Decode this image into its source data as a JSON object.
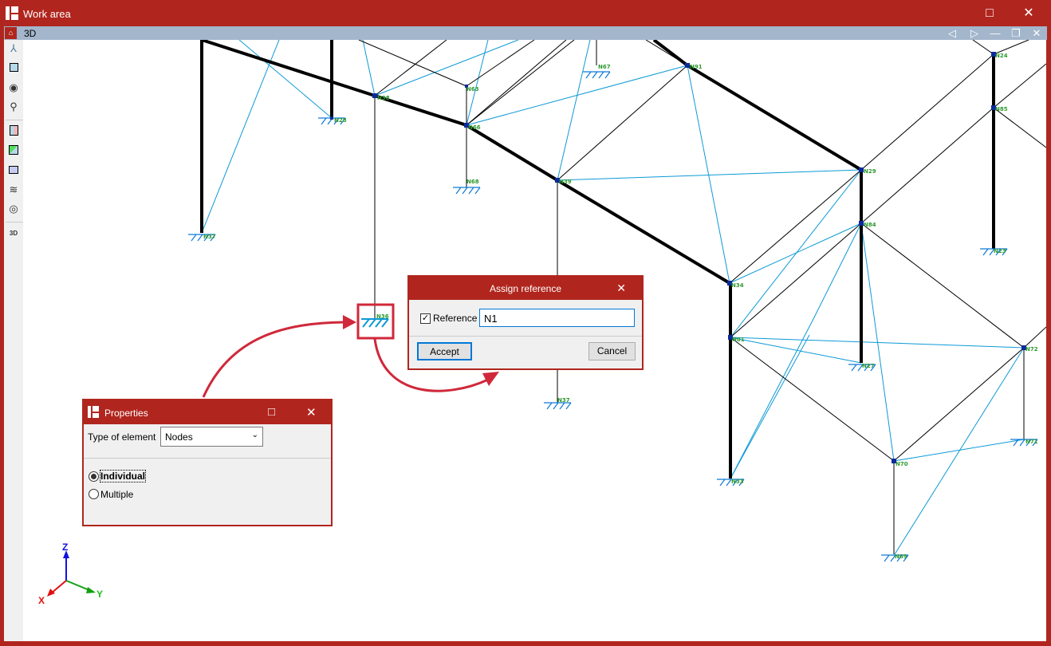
{
  "window": {
    "title": "Work area",
    "maximize_icon": "□",
    "close_icon": "✕"
  },
  "view": {
    "title": "3D",
    "prev_icon": "◁",
    "next_icon": "▷",
    "minimize_icon": "—",
    "restore_icon": "❐",
    "close_icon": "✕"
  },
  "toolbar": {
    "view_3d_settings_label": "3D"
  },
  "nodes": [
    "N37",
    "N28",
    "N38",
    "N63",
    "N66",
    "N68",
    "N67",
    "N91",
    "N39",
    "N29",
    "N84",
    "N24",
    "N85",
    "N23",
    "N34",
    "N81",
    "N27",
    "N33",
    "N72",
    "N71",
    "N70",
    "N69",
    "N36",
    "N37"
  ],
  "axes": {
    "x": "X",
    "y": "Y",
    "z": "Z"
  },
  "assign_reference": {
    "title": "Assign reference",
    "close_icon": "✕",
    "checkbox_label": "Reference",
    "checked": true,
    "input_value": "N1",
    "accept": "Accept",
    "cancel": "Cancel"
  },
  "properties": {
    "title": "Properties",
    "maximize_icon": "□",
    "close_icon": "✕",
    "type_label": "Type of element",
    "type_value": "Nodes",
    "options": [
      "Individual",
      "Multiple"
    ],
    "selected": "Individual"
  },
  "colors": {
    "brand": "#b0261e",
    "bracing": "#0d9ad6",
    "beam": "#000000",
    "node_label": "#2e9a2e"
  }
}
